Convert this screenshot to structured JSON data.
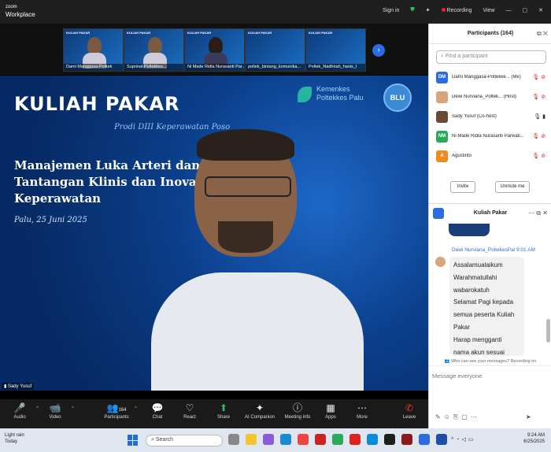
{
  "app": {
    "brand_line1": "zoom",
    "brand_line2": "Workplace"
  },
  "topbar": {
    "sign_in": "Sign in",
    "recording": "Recording",
    "view": "View",
    "minimize": "—",
    "restore": "▢",
    "close": "✕"
  },
  "thumbnails": [
    {
      "name": "Dami Manggasa-Politek"
    },
    {
      "name": "Suprinal-Poltekkes..."
    },
    {
      "name": "Ni Made Ridla Nurasanti Par..."
    },
    {
      "name": "poltek_bintang_komunika..."
    },
    {
      "name": "Poltek_Nadhirah_hanis_l"
    }
  ],
  "thumb_title": "KULIAH PAKAR",
  "slide": {
    "title": "KULIAH PAKAR",
    "subtitle": "Prodi DIII Keperawatan Poso",
    "heading_line1": "Manajemen Luka Arteri dan",
    "heading_line2": "Tantangan Klinis dan Inovasi ... m",
    "heading_line3": "Keperawatan",
    "date": "Palu, 25 Juni 2025",
    "logo_line1": "Kemenkes",
    "logo_line2": "Poltekkes Palu",
    "blu": "BLU"
  },
  "video_name": "Sady Yusuf",
  "controls": [
    {
      "icon": "🎤",
      "label": "Audio"
    },
    {
      "icon": "📹",
      "label": "Video"
    },
    {
      "icon": "👥",
      "label": "Participants",
      "badge": "164"
    },
    {
      "icon": "💬",
      "label": "Chat"
    },
    {
      "icon": "♡",
      "label": "React"
    },
    {
      "icon": "⬆",
      "label": "Share"
    },
    {
      "icon": "✦",
      "label": "AI Companion"
    },
    {
      "icon": "ⓘ",
      "label": "Meeting info"
    },
    {
      "icon": "▦",
      "label": "Apps"
    },
    {
      "icon": "⋯",
      "label": "More"
    },
    {
      "icon": "✆",
      "label": "Leave"
    }
  ],
  "participants": {
    "title": "Participants (164)",
    "search_placeholder": "Find a participant",
    "rows": [
      {
        "initials": "DM",
        "name": "Dami Manggasa-Poltekke... (Me)",
        "color": "#2d6cdf"
      },
      {
        "initials": "",
        "name": "Dewi Nurviana_Poltek... (Host)",
        "color": "#d9a57c"
      },
      {
        "initials": "",
        "name": "Sady Yusuf (Co-host)",
        "color": "#6b4a35"
      },
      {
        "initials": "NM",
        "name": "Ni Made Ridla Nurasanti Parwati...",
        "color": "#2aa85c"
      },
      {
        "initials": "A",
        "name": "Agustinto",
        "color": "#f08a1c"
      }
    ],
    "invite": "Invite",
    "unmute_me": "Unmute me"
  },
  "chat": {
    "title": "Kuliah Pakar",
    "sender": "Dewi Nurviana_PoltekesPal 9:01 AM",
    "lines": [
      "Assalamualaikum",
      "Warahmatullahi",
      "wabarokatuh",
      "Selamat Pagi kepada",
      "semua peserta Kuliah",
      "Pakar",
      "Harap mengganti",
      "nama akun sesuai"
    ],
    "notice": "Who can see your messages? Recording on",
    "placeholder": "Message everyone"
  },
  "taskbar": {
    "weather_temp": "Light rain",
    "weather_day": "Today",
    "search": "Search",
    "time": "9:24 AM",
    "date": "6/25/2025"
  }
}
